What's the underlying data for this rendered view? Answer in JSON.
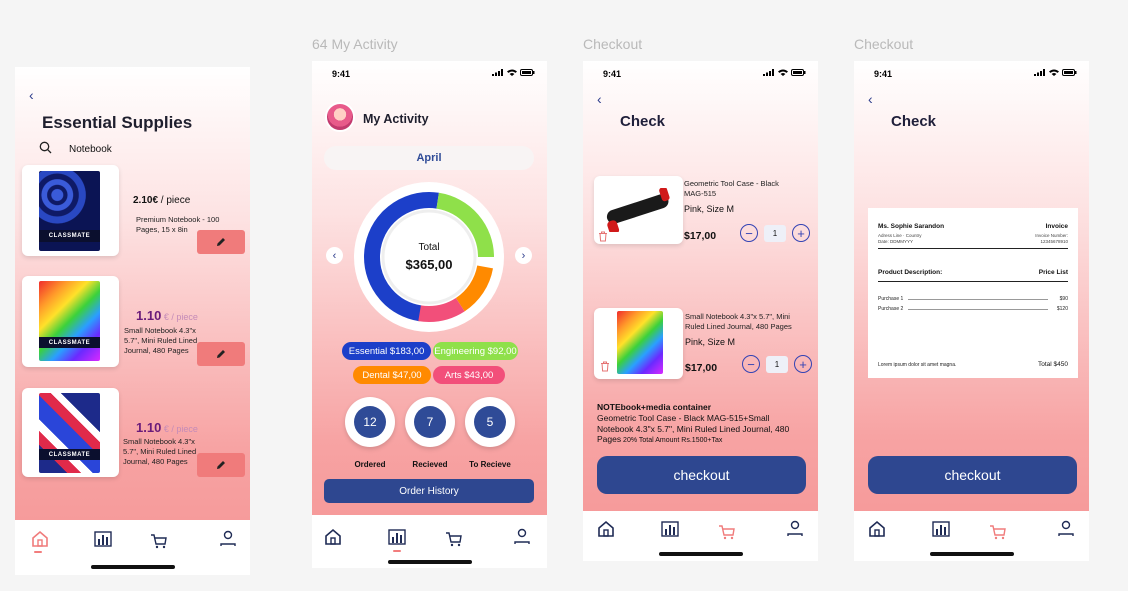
{
  "labels": {
    "frame2": "64 My Activity",
    "frame3": "Checkout",
    "frame4": "Checkout"
  },
  "status": {
    "time": "9:41"
  },
  "screen1": {
    "title": "Essential Supplies",
    "search_value": "Notebook",
    "products": [
      {
        "price_bold": "2.10€",
        "price_unit": " / piece",
        "desc": "Premium Notebook - 100 Pages, 15 x 8in"
      },
      {
        "price_bold": "1.10",
        "price_unit": " € / piece",
        "desc": "Small Notebook 4.3\"x 5.7\", Mini Ruled Lined Journal, 480 Pages"
      },
      {
        "price_bold": "1.10",
        "price_unit": " € / piece",
        "desc": "Small Notebook 4.3\"x 5.7\", Mini Ruled Lined Journal, 480 Pages"
      }
    ],
    "brand": "CLASSMATE"
  },
  "screen2": {
    "title": "My Activity",
    "month": "April",
    "total_label": "Total",
    "total_value": "$365,00",
    "pills": [
      "Essential $183,00",
      "Engineering $92,00",
      "Dental $47,00",
      "Arts $43,00"
    ],
    "stats": [
      {
        "value": "12",
        "label": "Ordered"
      },
      {
        "value": "7",
        "label": "Recieved"
      },
      {
        "value": "5",
        "label": "To Recieve"
      }
    ],
    "order_history": "Order History"
  },
  "screen3": {
    "title": "Check",
    "items": [
      {
        "name": "Geometric Tool Case - Black MAG-515",
        "variant": "Pink, Size M",
        "price": "$17,00",
        "qty": "1"
      },
      {
        "name": "Small Notebook 4.3\"x 5.7\", Mini Ruled Lined Journal, 480 Pages",
        "variant": "Pink, Size M",
        "price": "$17,00",
        "qty": "1"
      }
    ],
    "summary_title": "NOTEbook+media container",
    "summary_body": "Geometric Tool Case - Black MAG-515+Small Notebook 4.3\"x 5.7\", Mini Ruled Lined Journal, 480 Pages",
    "summary_tail": " 20% Total Amount Rs.1500+Tax",
    "checkout": "checkout"
  },
  "screen4": {
    "title": "Check",
    "invoice": {
      "name": "Ms. Sophie Sarandon",
      "invoice_label": "Invoice",
      "address_line1": "Adress Line · Country",
      "address_line2": "Date: DDMMYYY",
      "invoice_number_label": "Invoice Number:",
      "invoice_number": "12345678910",
      "product_desc": "Product Description:",
      "price_list": "Price List",
      "line1_label": "Purchase 1",
      "line1_value": "$90",
      "line2_label": "Purchase 2",
      "line2_value": "$120",
      "footer_note": "Lorem ipsum dolor sit amet magna.",
      "total": "Total $450"
    },
    "checkout": "checkout"
  },
  "colors": {
    "navy": "#2e4790",
    "coral": "#f07b7b",
    "essential": "#1c3fc9",
    "engineering": "#8fe04a",
    "dental": "#ff8a00",
    "arts": "#f24f7a"
  }
}
